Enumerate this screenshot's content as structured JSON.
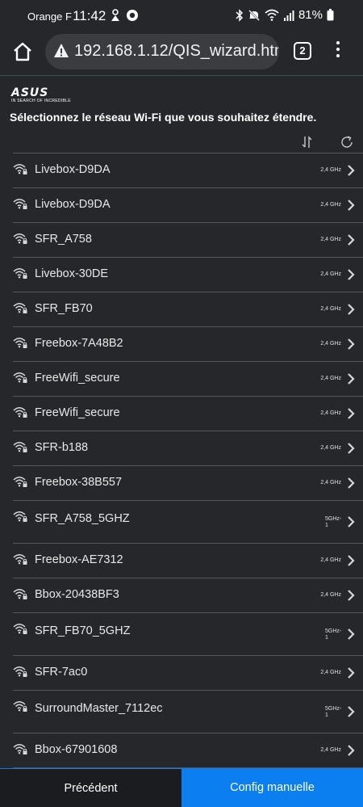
{
  "status_bar": {
    "carrier": "Orange F",
    "time": "11:42",
    "battery": "81%"
  },
  "browser": {
    "url": "192.168.1.12/QIS_wizard.htm",
    "tab_count": "2"
  },
  "header": {
    "logo": "ASUS",
    "logo_tagline": "IN SEARCH OF INCREDIBLE",
    "title": "Sélectionnez le réseau Wi-Fi que vous souhaitez étendre."
  },
  "networks": [
    {
      "ssid": "Livebox-D9DA",
      "band": "2,4 GHz"
    },
    {
      "ssid": "Livebox-D9DA",
      "band": "2,4 GHz"
    },
    {
      "ssid": "SFR_A758",
      "band": "2,4 GHz"
    },
    {
      "ssid": "Livebox-30DE",
      "band": "2,4 GHz"
    },
    {
      "ssid": "SFR_FB70",
      "band": "2,4 GHz"
    },
    {
      "ssid": "Freebox-7A48B2",
      "band": "2,4 GHz"
    },
    {
      "ssid": "FreeWifi_secure",
      "band": "2,4 GHz"
    },
    {
      "ssid": "FreeWifi_secure",
      "band": "2,4 GHz"
    },
    {
      "ssid": "SFR-b188",
      "band": "2,4 GHz"
    },
    {
      "ssid": "Freebox-38B557",
      "band": "2,4 GHz"
    },
    {
      "ssid": "SFR_A758_5GHZ",
      "band": "5GHz-1"
    },
    {
      "ssid": "Freebox-AE7312",
      "band": "2,4 GHz"
    },
    {
      "ssid": "Bbox-20438BF3",
      "band": "2,4 GHz"
    },
    {
      "ssid": "SFR_FB70_5GHZ",
      "band": "5GHz-1"
    },
    {
      "ssid": "SFR-7ac0",
      "band": "2,4 GHz"
    },
    {
      "ssid": "SurroundMaster_7112ec",
      "band": "5GHz-1"
    },
    {
      "ssid": "Bbox-67901608",
      "band": "2,4 GHz"
    }
  ],
  "footer": {
    "previous_label": "Précédent",
    "manual_label": "Config manuelle"
  },
  "icons": {
    "wifi": "wifi-lock-icon",
    "chevron": "chevron-right-icon",
    "sort": "sort-icon",
    "refresh": "refresh-icon"
  },
  "colors": {
    "background": "#26272b",
    "accent": "#0b7ff0"
  }
}
